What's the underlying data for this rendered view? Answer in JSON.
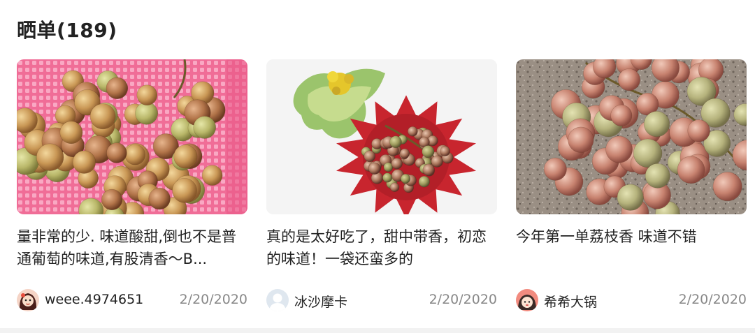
{
  "section": {
    "title": "晒单(189)"
  },
  "reviews": [
    {
      "text": "量非常的少. 味道酸甜,倒也不是普通葡萄的味道,有股清香～B...",
      "user": "weee.4974651",
      "date": "2/20/2020",
      "photo_icon": "grapes-in-pink-basket",
      "avatar_icon": "cartoon-girl-avatar"
    },
    {
      "text": "真的是太好吃了，甜中带香，初恋的味道！一袋还蛮多的",
      "user": "冰沙摩卡",
      "date": "2/20/2020",
      "photo_icon": "grapes-on-red-plate",
      "avatar_icon": "default-user-avatar"
    },
    {
      "text": "今年第一单荔枝香 味道不错",
      "user": "希希大锅",
      "date": "2/20/2020",
      "photo_icon": "grapes-on-granite",
      "avatar_icon": "cartoon-face-avatar"
    }
  ]
}
